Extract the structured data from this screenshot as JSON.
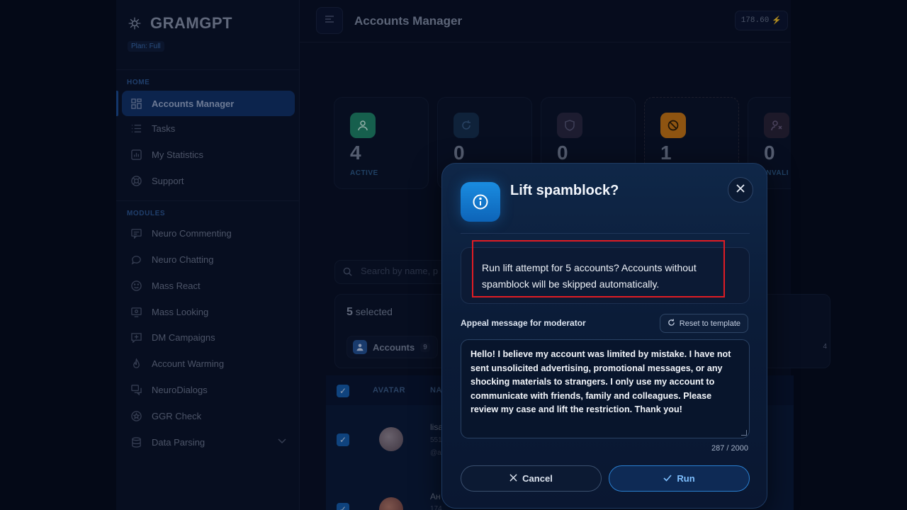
{
  "sidebar": {
    "brand": "GRAMGPT",
    "plan": "Plan: Full",
    "home_label": "HOME",
    "modules_label": "MODULES",
    "home_items": [
      {
        "label": "Accounts Manager",
        "icon": "grid-icon"
      },
      {
        "label": "Tasks",
        "icon": "list-icon"
      },
      {
        "label": "My Statistics",
        "icon": "chart-icon"
      },
      {
        "label": "Support",
        "icon": "lifebuoy-icon"
      }
    ],
    "module_items": [
      {
        "label": "Neuro Commenting",
        "icon": "comments-icon"
      },
      {
        "label": "Neuro Chatting",
        "icon": "chat-bubble-icon"
      },
      {
        "label": "Mass React",
        "icon": "smile-icon"
      },
      {
        "label": "Mass Looking",
        "icon": "eye-monitor-icon"
      },
      {
        "label": "DM Campaigns",
        "icon": "message-plus-icon"
      },
      {
        "label": "Account Warming",
        "icon": "flame-icon"
      },
      {
        "label": "NeuroDialogs",
        "icon": "dialogs-icon"
      },
      {
        "label": "GGR Check",
        "icon": "star-circle-icon"
      },
      {
        "label": "Data Parsing",
        "icon": "database-icon"
      }
    ]
  },
  "header": {
    "title": "Accounts Manager",
    "balance": "178.60"
  },
  "stats": [
    {
      "value": "4",
      "label": "ACTIVE",
      "color": "#1f8a6a"
    },
    {
      "value": "0",
      "label": "",
      "color": "#15304f"
    },
    {
      "value": "0",
      "label": "",
      "color": "#2a2740"
    },
    {
      "value": "1",
      "label": "",
      "color": "#d07a12"
    },
    {
      "value": "0",
      "label": "INVALI",
      "color": "#2a2236"
    }
  ],
  "search": {
    "placeholder": "Search by name, p"
  },
  "selection": {
    "count": "5",
    "suffix": "selected",
    "chip_label": "Accounts",
    "chip_count": "9",
    "right_count": "4"
  },
  "table": {
    "col_avatar": "AVATAR",
    "col_name": "NA",
    "rows": [
      {
        "name": "lisa",
        "sub1": "551",
        "sub2": "@a"
      },
      {
        "name": "Ан",
        "sub1": "174",
        "sub2": ""
      }
    ]
  },
  "modal": {
    "title": "Lift spamblock?",
    "message": "Run lift attempt for 5 accounts? Accounts without spamblock will be skipped automatically.",
    "appeal_label": "Appeal message for moderator",
    "reset_label": "Reset to template",
    "appeal_text": "Hello! I believe my account was limited by mistake. I have not sent unsolicited advertising, promotional messages, or any shocking materials to strangers. I only use my account to communicate with friends, family and colleagues. Please review my case and lift the restriction. Thank you!",
    "char_count": "287 / 2000",
    "cancel_label": "Cancel",
    "run_label": "Run"
  },
  "colors": {
    "accent": "#1a8ce0",
    "highlight": "#e01c24"
  }
}
